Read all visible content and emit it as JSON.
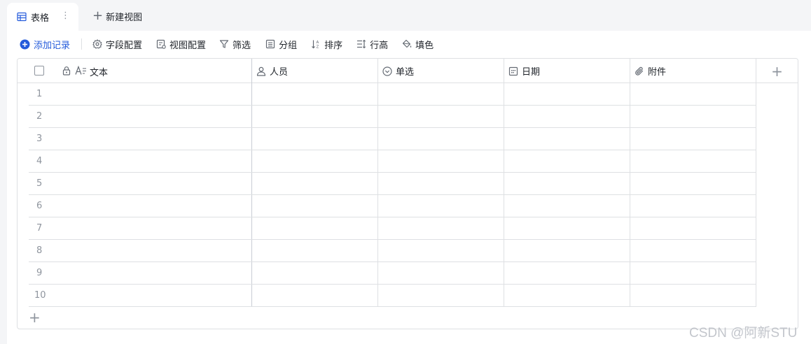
{
  "tabs": {
    "active_label": "表格",
    "more_glyph": "⋮",
    "new_view_label": "新建视图",
    "plus_glyph": "+"
  },
  "toolbar": {
    "add_record": "添加记录",
    "field_config": "字段配置",
    "view_config": "视图配置",
    "filter": "筛选",
    "group": "分组",
    "sort": "排序",
    "row_height": "行高",
    "fill_color": "填色"
  },
  "columns": [
    {
      "label": "文本",
      "icon": "text-icon"
    },
    {
      "label": "人员",
      "icon": "person-icon"
    },
    {
      "label": "单选",
      "icon": "single-select-icon"
    },
    {
      "label": "日期",
      "icon": "calendar-icon"
    },
    {
      "label": "附件",
      "icon": "paperclip-icon"
    }
  ],
  "add_column_glyph": "+",
  "rows": [
    "1",
    "2",
    "3",
    "4",
    "5",
    "6",
    "7",
    "8",
    "9",
    "10"
  ],
  "add_row_glyph": "+",
  "watermark": "CSDN @阿新STU",
  "colors": {
    "accent": "#245bdb",
    "border": "#dee0e3",
    "muted": "#8f959e"
  }
}
